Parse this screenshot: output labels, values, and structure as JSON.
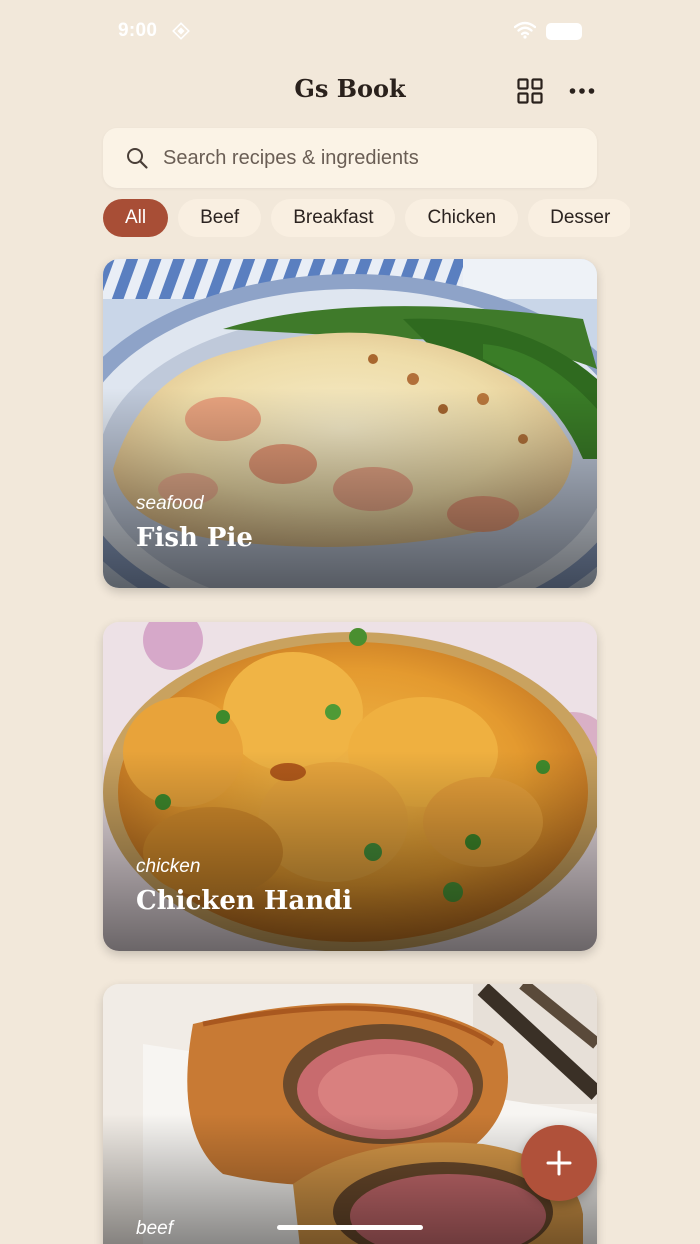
{
  "status_bar": {
    "time": "9:00"
  },
  "header": {
    "title": "Gs Book"
  },
  "search": {
    "placeholder": "Search recipes & ingredients"
  },
  "chips": [
    "All",
    "Beef",
    "Breakfast",
    "Chicken",
    "Desser"
  ],
  "recipes": [
    {
      "category": "seafood",
      "title": "Fish Pie"
    },
    {
      "category": "chicken",
      "title": "Chicken Handi"
    },
    {
      "category": "beef",
      "title": ""
    }
  ],
  "icons": {
    "status": [
      "diamond-icon",
      "wifi-icon",
      "battery-icon"
    ],
    "header": [
      "grid-view-icon",
      "more-icon"
    ],
    "search": "search-icon",
    "fab": "plus-icon"
  },
  "colors": {
    "background": "#f2e8da",
    "accent": "#a84e36",
    "fab": "#b0513a",
    "chip": "#f9efe1",
    "search_bg": "#fbf3e6"
  }
}
